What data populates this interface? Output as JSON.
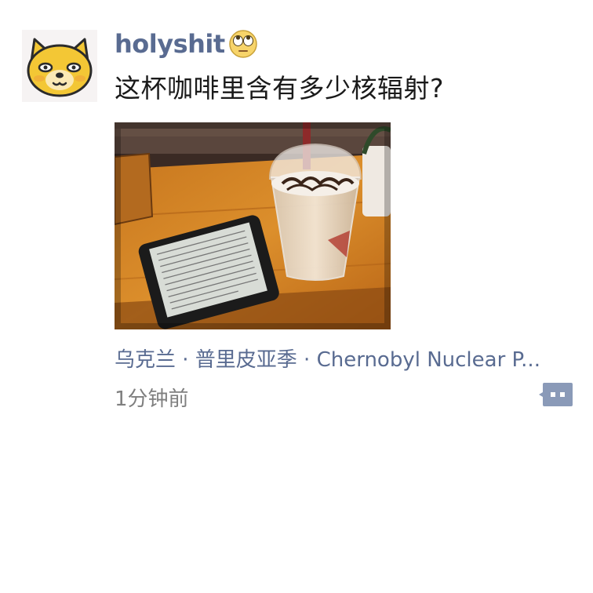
{
  "post": {
    "username": "holyshit",
    "username_emoji": "eye-roll-emoji-icon",
    "text": "这杯咖啡里含有多少核辐射?",
    "location": "乌克兰 · 普里皮亚季 · Chernobyl Nuclear P...",
    "timestamp": "1分钟前"
  },
  "icons": {
    "avatar": "cartoon-dog-avatar",
    "comment": "comment-bubble-icon"
  },
  "colors": {
    "username": "#596b91",
    "location": "#596b91",
    "timestamp": "#7f7f7f",
    "comment_button": "#8a9ab8"
  }
}
